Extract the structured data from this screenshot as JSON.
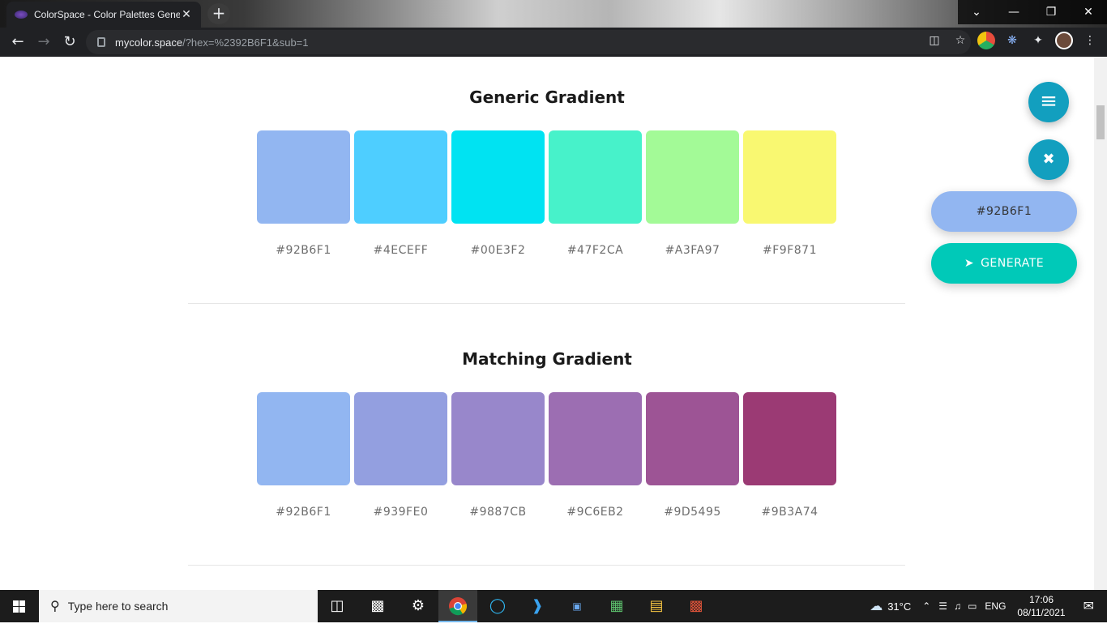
{
  "browser": {
    "tab_title": "ColorSpace - Color Palettes Gene",
    "tab_close": "✕",
    "new_tab": "+",
    "url_host": "mycolor.space",
    "url_path": "/?hex=%2392B6F1&sub=1",
    "window_controls": [
      "⌄",
      "—",
      "❐",
      "✕"
    ]
  },
  "sections": [
    {
      "title": "Generic Gradient",
      "swatches": [
        {
          "hex": "#92B6F1",
          "color": "#92B6F1"
        },
        {
          "hex": "#4ECEFF",
          "color": "#4ECEFF"
        },
        {
          "hex": "#00E3F2",
          "color": "#00E3F2"
        },
        {
          "hex": "#47F2CA",
          "color": "#47F2CA"
        },
        {
          "hex": "#A3FA97",
          "color": "#A3FA97"
        },
        {
          "hex": "#F9F871",
          "color": "#F9F871"
        }
      ]
    },
    {
      "title": "Matching Gradient",
      "swatches": [
        {
          "hex": "#92B6F1",
          "color": "#92B6F1"
        },
        {
          "hex": "#939FE0",
          "color": "#939FE0"
        },
        {
          "hex": "#9887CB",
          "color": "#9887CB"
        },
        {
          "hex": "#9C6EB2",
          "color": "#9C6EB2"
        },
        {
          "hex": "#9D5495",
          "color": "#9D5495"
        },
        {
          "hex": "#9B3A74",
          "color": "#9B3A74"
        }
      ]
    }
  ],
  "controls": {
    "menu_icon": "≡",
    "close_icon": "✖",
    "current_hex": "#92B6F1",
    "generate_label": "GENERATE",
    "generate_color": "#00C9B8",
    "fab_color": "#129FBF"
  },
  "taskbar": {
    "search_placeholder": "Type here to search",
    "weather": "31°C",
    "language": "ENG",
    "time": "17:06",
    "date": "08/11/2021"
  }
}
